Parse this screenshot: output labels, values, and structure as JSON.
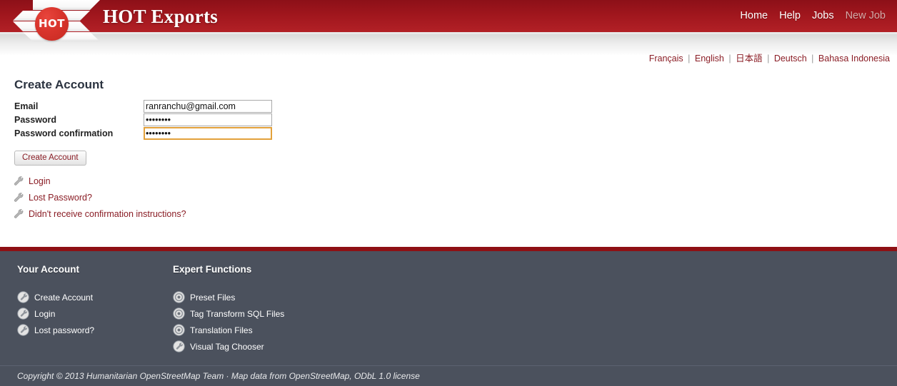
{
  "header": {
    "logo": {
      "badge_text": "HOT",
      "icon": "hot-ribbon-logo"
    },
    "title": "HOT Exports",
    "nav": [
      {
        "label": "Home",
        "state": "normal"
      },
      {
        "label": "Help",
        "state": "normal"
      },
      {
        "label": "Jobs",
        "state": "normal"
      },
      {
        "label": "New Job",
        "state": "dim"
      }
    ]
  },
  "languages": [
    {
      "label": "Français"
    },
    {
      "label": "English"
    },
    {
      "label": "日本語"
    },
    {
      "label": "Deutsch"
    },
    {
      "label": "Bahasa Indonesia"
    }
  ],
  "lang_separator": "|",
  "main": {
    "title": "Create Account",
    "fields": [
      {
        "label": "Email",
        "value": "ranranchu@gmail.com",
        "type": "text",
        "focused": false
      },
      {
        "label": "Password",
        "value": "••••••••",
        "type": "password",
        "focused": false
      },
      {
        "label": "Password confirmation",
        "value": "••••••••",
        "type": "password",
        "focused": true
      }
    ],
    "submit_label": "Create Account",
    "links": [
      {
        "label": "Login",
        "icon": "wrench-icon"
      },
      {
        "label": "Lost Password?",
        "icon": "wrench-icon"
      },
      {
        "label": "Didn't receive confirmation instructions?",
        "icon": "wrench-icon"
      }
    ]
  },
  "footer": {
    "columns": [
      {
        "heading": "Your Account",
        "items": [
          {
            "label": "Create Account",
            "icon": "wrench-badge-icon"
          },
          {
            "label": "Login",
            "icon": "wrench-badge-icon"
          },
          {
            "label": "Lost password?",
            "icon": "wrench-badge-icon"
          }
        ]
      },
      {
        "heading": "Expert Functions",
        "items": [
          {
            "label": "Preset Files",
            "icon": "target-badge-icon"
          },
          {
            "label": "Tag Transform SQL Files",
            "icon": "target-badge-icon"
          },
          {
            "label": "Translation Files",
            "icon": "target-badge-icon"
          },
          {
            "label": "Visual Tag Chooser",
            "icon": "wrench-badge-icon"
          }
        ]
      }
    ],
    "copyright": "Copyright © 2013 Humanitarian OpenStreetMap Team · Map data from OpenStreetMap, ODbL 1.0 license"
  },
  "colors": {
    "header_red_top": "#8c1018",
    "header_red_bottom": "#b22026",
    "link_red": "#8a1d25",
    "footer_slate": "#4b515d",
    "footer_rule_red": "#8e1014",
    "focus_gold": "#e3a13b"
  }
}
